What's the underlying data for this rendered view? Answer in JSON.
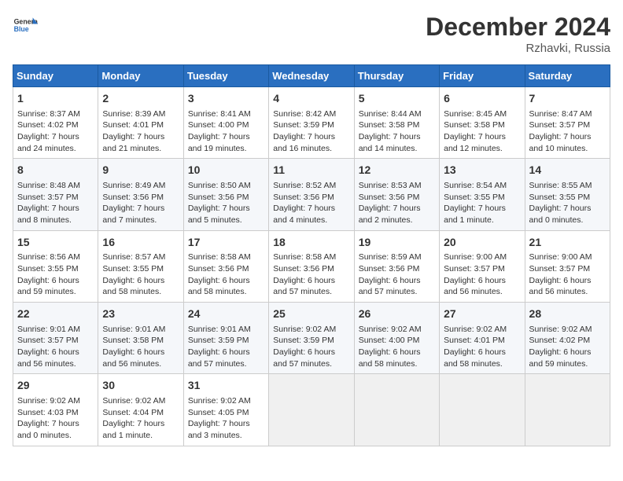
{
  "header": {
    "logo_general": "General",
    "logo_blue": "Blue",
    "month_title": "December 2024",
    "location": "Rzhavki, Russia"
  },
  "days_of_week": [
    "Sunday",
    "Monday",
    "Tuesday",
    "Wednesday",
    "Thursday",
    "Friday",
    "Saturday"
  ],
  "weeks": [
    [
      {
        "day": "1",
        "info": "Sunrise: 8:37 AM\nSunset: 4:02 PM\nDaylight: 7 hours\nand 24 minutes."
      },
      {
        "day": "2",
        "info": "Sunrise: 8:39 AM\nSunset: 4:01 PM\nDaylight: 7 hours\nand 21 minutes."
      },
      {
        "day": "3",
        "info": "Sunrise: 8:41 AM\nSunset: 4:00 PM\nDaylight: 7 hours\nand 19 minutes."
      },
      {
        "day": "4",
        "info": "Sunrise: 8:42 AM\nSunset: 3:59 PM\nDaylight: 7 hours\nand 16 minutes."
      },
      {
        "day": "5",
        "info": "Sunrise: 8:44 AM\nSunset: 3:58 PM\nDaylight: 7 hours\nand 14 minutes."
      },
      {
        "day": "6",
        "info": "Sunrise: 8:45 AM\nSunset: 3:58 PM\nDaylight: 7 hours\nand 12 minutes."
      },
      {
        "day": "7",
        "info": "Sunrise: 8:47 AM\nSunset: 3:57 PM\nDaylight: 7 hours\nand 10 minutes."
      }
    ],
    [
      {
        "day": "8",
        "info": "Sunrise: 8:48 AM\nSunset: 3:57 PM\nDaylight: 7 hours\nand 8 minutes."
      },
      {
        "day": "9",
        "info": "Sunrise: 8:49 AM\nSunset: 3:56 PM\nDaylight: 7 hours\nand 7 minutes."
      },
      {
        "day": "10",
        "info": "Sunrise: 8:50 AM\nSunset: 3:56 PM\nDaylight: 7 hours\nand 5 minutes."
      },
      {
        "day": "11",
        "info": "Sunrise: 8:52 AM\nSunset: 3:56 PM\nDaylight: 7 hours\nand 4 minutes."
      },
      {
        "day": "12",
        "info": "Sunrise: 8:53 AM\nSunset: 3:56 PM\nDaylight: 7 hours\nand 2 minutes."
      },
      {
        "day": "13",
        "info": "Sunrise: 8:54 AM\nSunset: 3:55 PM\nDaylight: 7 hours\nand 1 minute."
      },
      {
        "day": "14",
        "info": "Sunrise: 8:55 AM\nSunset: 3:55 PM\nDaylight: 7 hours\nand 0 minutes."
      }
    ],
    [
      {
        "day": "15",
        "info": "Sunrise: 8:56 AM\nSunset: 3:55 PM\nDaylight: 6 hours\nand 59 minutes."
      },
      {
        "day": "16",
        "info": "Sunrise: 8:57 AM\nSunset: 3:55 PM\nDaylight: 6 hours\nand 58 minutes."
      },
      {
        "day": "17",
        "info": "Sunrise: 8:58 AM\nSunset: 3:56 PM\nDaylight: 6 hours\nand 58 minutes."
      },
      {
        "day": "18",
        "info": "Sunrise: 8:58 AM\nSunset: 3:56 PM\nDaylight: 6 hours\nand 57 minutes."
      },
      {
        "day": "19",
        "info": "Sunrise: 8:59 AM\nSunset: 3:56 PM\nDaylight: 6 hours\nand 57 minutes."
      },
      {
        "day": "20",
        "info": "Sunrise: 9:00 AM\nSunset: 3:57 PM\nDaylight: 6 hours\nand 56 minutes."
      },
      {
        "day": "21",
        "info": "Sunrise: 9:00 AM\nSunset: 3:57 PM\nDaylight: 6 hours\nand 56 minutes."
      }
    ],
    [
      {
        "day": "22",
        "info": "Sunrise: 9:01 AM\nSunset: 3:57 PM\nDaylight: 6 hours\nand 56 minutes."
      },
      {
        "day": "23",
        "info": "Sunrise: 9:01 AM\nSunset: 3:58 PM\nDaylight: 6 hours\nand 56 minutes."
      },
      {
        "day": "24",
        "info": "Sunrise: 9:01 AM\nSunset: 3:59 PM\nDaylight: 6 hours\nand 57 minutes."
      },
      {
        "day": "25",
        "info": "Sunrise: 9:02 AM\nSunset: 3:59 PM\nDaylight: 6 hours\nand 57 minutes."
      },
      {
        "day": "26",
        "info": "Sunrise: 9:02 AM\nSunset: 4:00 PM\nDaylight: 6 hours\nand 58 minutes."
      },
      {
        "day": "27",
        "info": "Sunrise: 9:02 AM\nSunset: 4:01 PM\nDaylight: 6 hours\nand 58 minutes."
      },
      {
        "day": "28",
        "info": "Sunrise: 9:02 AM\nSunset: 4:02 PM\nDaylight: 6 hours\nand 59 minutes."
      }
    ],
    [
      {
        "day": "29",
        "info": "Sunrise: 9:02 AM\nSunset: 4:03 PM\nDaylight: 7 hours\nand 0 minutes."
      },
      {
        "day": "30",
        "info": "Sunrise: 9:02 AM\nSunset: 4:04 PM\nDaylight: 7 hours\nand 1 minute."
      },
      {
        "day": "31",
        "info": "Sunrise: 9:02 AM\nSunset: 4:05 PM\nDaylight: 7 hours\nand 3 minutes."
      },
      {
        "day": "",
        "info": ""
      },
      {
        "day": "",
        "info": ""
      },
      {
        "day": "",
        "info": ""
      },
      {
        "day": "",
        "info": ""
      }
    ]
  ]
}
